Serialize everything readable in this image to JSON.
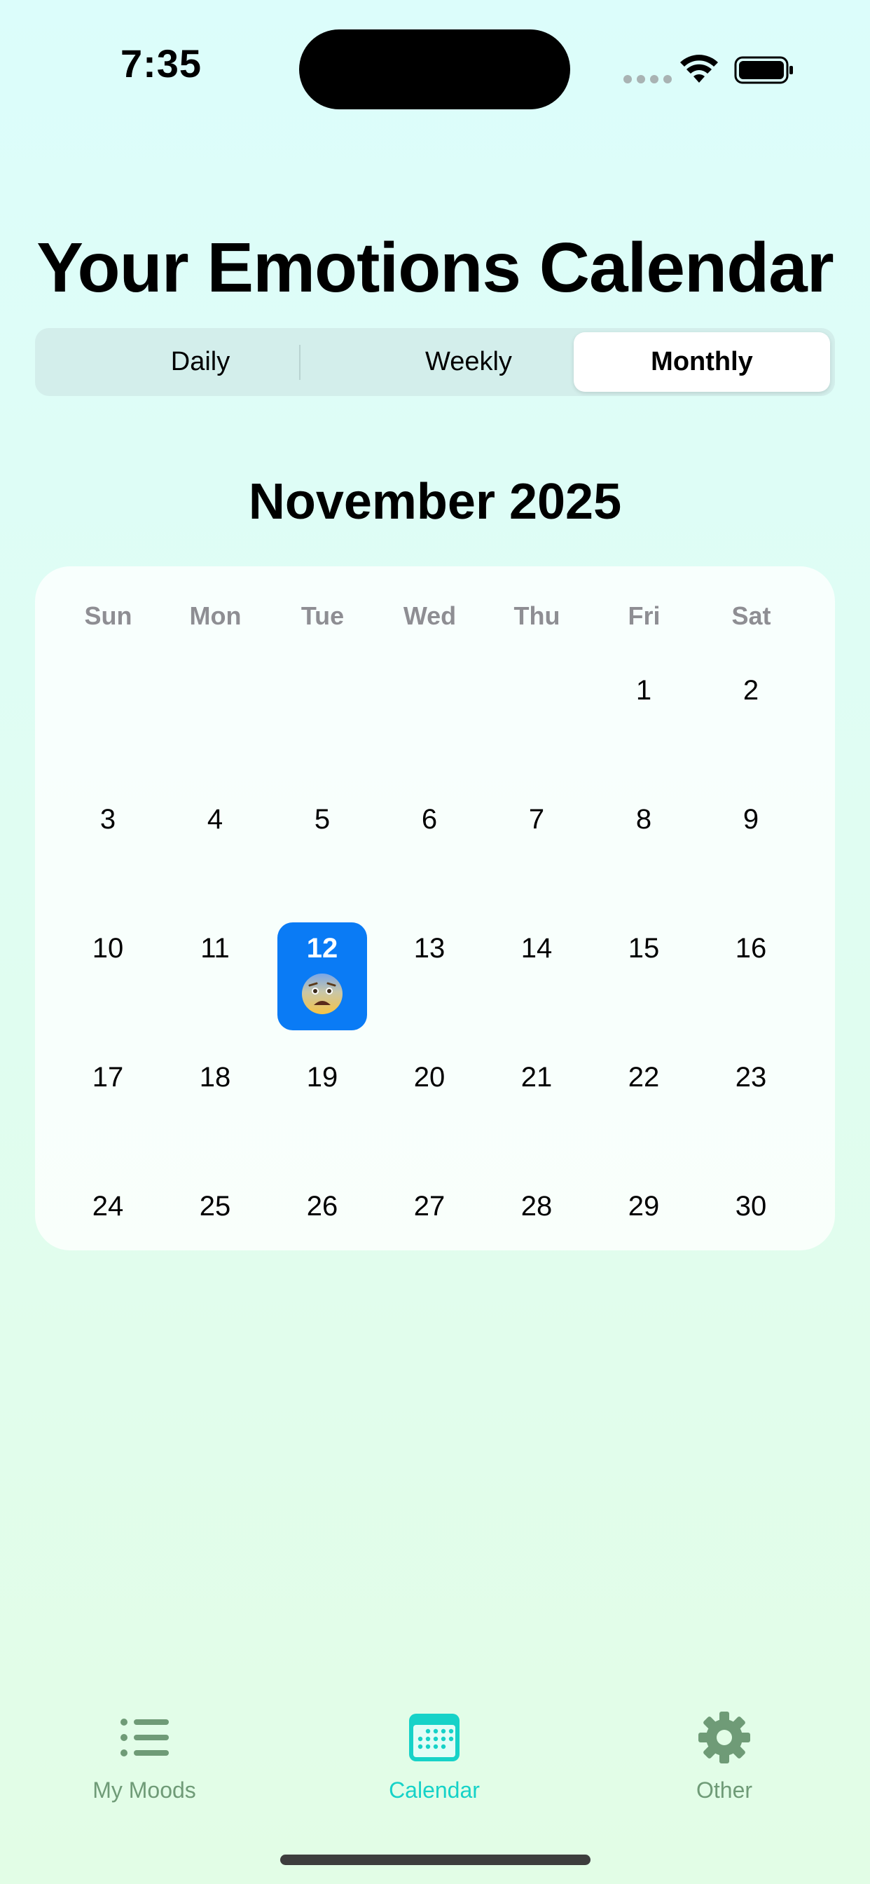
{
  "status_bar": {
    "time": "7:35"
  },
  "header": {
    "title": "Your Emotions Calendar"
  },
  "view_switcher": {
    "options": [
      "Daily",
      "Weekly",
      "Monthly"
    ],
    "selected": "Monthly"
  },
  "calendar": {
    "month_label": "November 2025",
    "weekdays": [
      "Sun",
      "Mon",
      "Tue",
      "Wed",
      "Thu",
      "Fri",
      "Sat"
    ],
    "days": [
      "1",
      "2",
      "3",
      "4",
      "5",
      "6",
      "7",
      "8",
      "9",
      "10",
      "11",
      "12",
      "13",
      "14",
      "15",
      "16",
      "17",
      "18",
      "19",
      "20",
      "21",
      "22",
      "23",
      "24",
      "25",
      "26",
      "27",
      "28",
      "29",
      "30"
    ],
    "first_weekday_index": 5,
    "selected_day": "12",
    "selected_day_mood": "anxious-face-emoji"
  },
  "tab_bar": {
    "items": [
      {
        "label": "My Moods",
        "icon": "list-icon"
      },
      {
        "label": "Calendar",
        "icon": "calendar-icon"
      },
      {
        "label": "Other",
        "icon": "gear-icon"
      }
    ],
    "active": "Calendar"
  },
  "colors": {
    "accent_blue": "#0a7bf5",
    "tab_active": "#16d2c8",
    "tab_inactive": "#6f9b77"
  }
}
